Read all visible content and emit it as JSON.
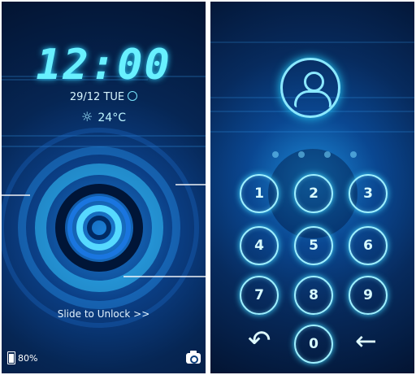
{
  "left": {
    "time": "12:00",
    "date": "29/12 TUE",
    "temperature": "24°C",
    "slide_label": "Slide to Unlock",
    "slide_arrows": ">>",
    "battery": "80%",
    "battery_level": 0.8,
    "icons": [
      "alarm-clock-icon",
      "sun-icon",
      "battery-icon",
      "camera-icon"
    ]
  },
  "right": {
    "keys": [
      "1",
      "2",
      "3",
      "4",
      "5",
      "6",
      "7",
      "8",
      "9",
      "0"
    ],
    "icons": [
      "user-icon",
      "back-arrow-icon",
      "delete-arrow-icon"
    ]
  },
  "colors": {
    "accent": "#68f0ff",
    "background": "#062654",
    "glow": "#1b7fd6"
  }
}
